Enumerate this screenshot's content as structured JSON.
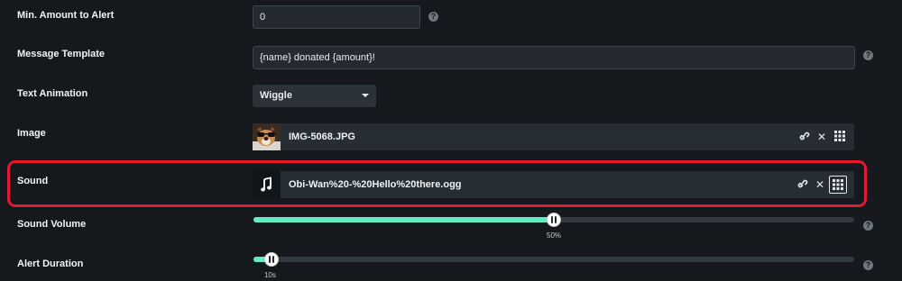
{
  "colors": {
    "accent": "#63ebc4",
    "background": "#15191d",
    "highlight": "#e3192c"
  },
  "fields": {
    "min_amount": {
      "label": "Min. Amount to Alert",
      "value": "0"
    },
    "message_template": {
      "label": "Message Template",
      "value": "{name} donated {amount}!"
    },
    "text_animation": {
      "label": "Text Animation",
      "value": "Wiggle"
    },
    "image": {
      "label": "Image",
      "filename": "IMG-5068.JPG"
    },
    "sound": {
      "label": "Sound",
      "filename": "Obi-Wan%20-%20Hello%20there.ogg",
      "file_icon": "music-note-icon"
    },
    "sound_volume": {
      "label": "Sound Volume",
      "value_label": "50%",
      "fraction": 0.5
    },
    "alert_duration": {
      "label": "Alert Duration",
      "value_label": "10s",
      "fraction": 0.03
    }
  },
  "help_icon": "?"
}
